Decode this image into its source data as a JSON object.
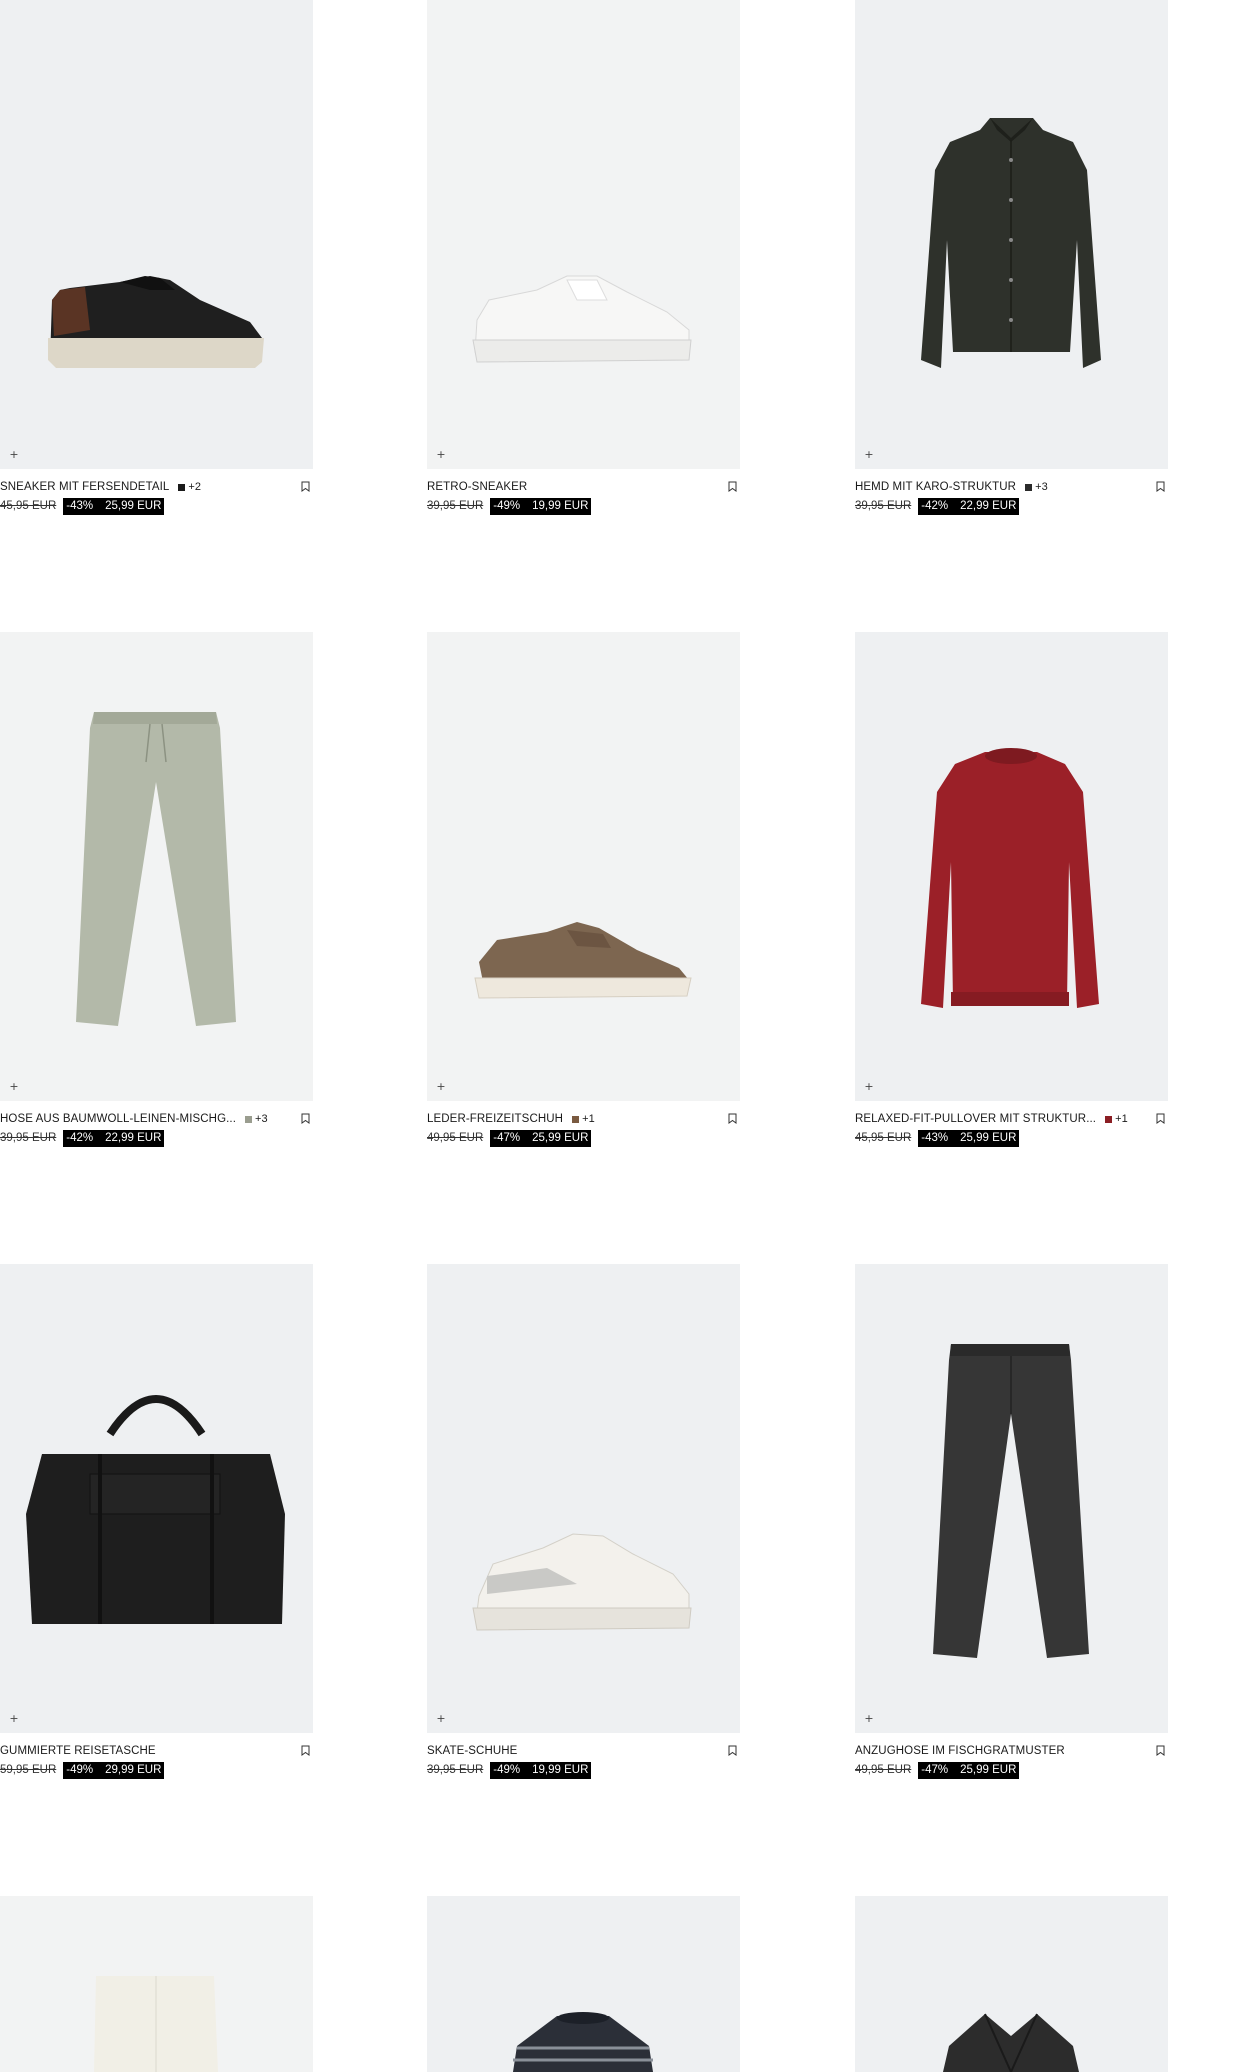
{
  "products": [
    {
      "name": "SNEAKER MIT FERSENDETAIL",
      "swatch": "#1a1a1a",
      "more": "+2",
      "old_price": "45,95 EUR",
      "discount": "-43%",
      "price": "25,99 EUR",
      "icon": "sneaker-black"
    },
    {
      "name": "RETRO-SNEAKER",
      "swatch": "",
      "more": "",
      "old_price": "39,95 EUR",
      "discount": "-49%",
      "price": "19,99 EUR",
      "icon": "sneaker-white"
    },
    {
      "name": "HEMD MIT KARO-STRUKTUR",
      "swatch": "#2b2b2b",
      "more": "+3",
      "old_price": "39,95 EUR",
      "discount": "-42%",
      "price": "22,99 EUR",
      "icon": "shirt-dark-green"
    },
    {
      "name": "HOSE AUS BAUMWOLL-LEINEN-MISCHG...",
      "swatch": "#9a9d8f",
      "more": "+3",
      "old_price": "39,95 EUR",
      "discount": "-42%",
      "price": "22,99 EUR",
      "icon": "trousers-sage"
    },
    {
      "name": "LEDER-FREIZEITSCHUH",
      "swatch": "#7a5a40",
      "more": "+1",
      "old_price": "49,95 EUR",
      "discount": "-47%",
      "price": "25,99 EUR",
      "icon": "moccasin-brown"
    },
    {
      "name": "RELAXED-FIT-PULLOVER MIT STRUKTUR...",
      "swatch": "#8b1e24",
      "more": "+1",
      "old_price": "45,95 EUR",
      "discount": "-43%",
      "price": "25,99 EUR",
      "icon": "sweater-red"
    },
    {
      "name": "GUMMIERTE REISETASCHE",
      "swatch": "",
      "more": "",
      "old_price": "59,95 EUR",
      "discount": "-49%",
      "price": "29,99 EUR",
      "icon": "duffel-bag-black"
    },
    {
      "name": "SKATE-SCHUHE",
      "swatch": "",
      "more": "",
      "old_price": "39,95 EUR",
      "discount": "-49%",
      "price": "19,99 EUR",
      "icon": "skate-shoe-white"
    },
    {
      "name": "ANZUGHOSE IM FISCHGRÄTMUSTER",
      "swatch": "",
      "more": "",
      "old_price": "49,95 EUR",
      "discount": "-47%",
      "price": "25,99 EUR",
      "icon": "suit-trousers-grey"
    }
  ],
  "partial_products": [
    {
      "icon": "trousers-white"
    },
    {
      "icon": "striped-sweater"
    },
    {
      "icon": "blazer-dark"
    }
  ],
  "add_symbol": "+"
}
